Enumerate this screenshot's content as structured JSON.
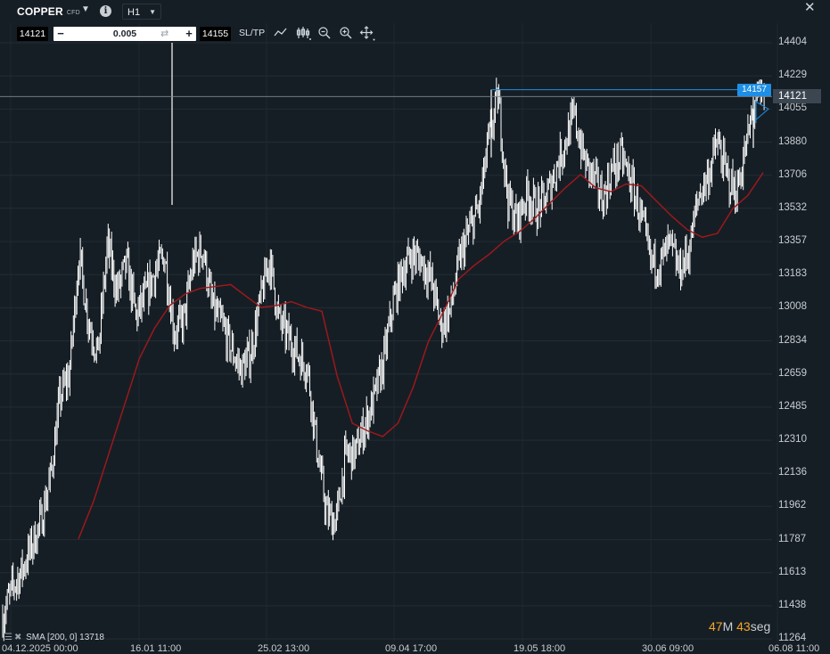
{
  "header": {
    "symbol": "COPPER",
    "symbol_suffix": "CFD",
    "timeframe": "H1",
    "close_glyph": "✕"
  },
  "order": {
    "bid": "14121",
    "ask": "14155",
    "quantity": "0.005",
    "minus": "−",
    "plus": "+",
    "sltp_label": "SL/TP"
  },
  "toolbar": {
    "icons": [
      "line-chart-icon",
      "indicators-icon",
      "zoom-out-icon",
      "zoom-in-icon",
      "crosshair-move-icon"
    ]
  },
  "price_axis": {
    "labels": [
      "14404",
      "14229",
      "14055",
      "13880",
      "13706",
      "13532",
      "13357",
      "13183",
      "13008",
      "12834",
      "12659",
      "12485",
      "12310",
      "12136",
      "11962",
      "11787",
      "11613",
      "11438",
      "11264"
    ],
    "current_price": "14121",
    "high_marker": "14157"
  },
  "time_axis": {
    "labels": [
      "04.12.2025 00:00",
      "16.01 11:00",
      "25.02 13:00",
      "09.04 17:00",
      "19.05 18:00",
      "30.06 09:00",
      "06.08 11:00"
    ]
  },
  "timer": {
    "minutes": "47",
    "m_unit": "M",
    "seconds": "43",
    "s_unit": "seg"
  },
  "legend": {
    "text": "SMA [200, 0] 13718"
  },
  "colors": {
    "background": "#161e25",
    "candles": "#ffffff",
    "sma": "#a3181b",
    "high_line": "#1e8fe6",
    "timer_accent": "#f5a623"
  },
  "chart_data": {
    "type": "line",
    "instrument": "COPPER",
    "timeframe": "H1",
    "ylim": [
      11264,
      14404
    ],
    "x": [
      "04.12.2025 00:00",
      "16.01 11:00",
      "25.02 13:00",
      "09.04 17:00",
      "19.05 18:00",
      "30.06 09:00",
      "06.08 11:00"
    ],
    "series": [
      {
        "name": "SMA [200, 0]",
        "values": [
          11790,
          11990,
          12240,
          12490,
          12740,
          12900,
          13020,
          13080,
          13110,
          13120,
          13130,
          13070,
          13010,
          13020,
          13040,
          13010,
          12990,
          12650,
          12400,
          12360,
          12330,
          12400,
          12590,
          12830,
          12990,
          13160,
          13230,
          13290,
          13360,
          13410,
          13480,
          13560,
          13640,
          13710,
          13640,
          13620,
          13660,
          13650,
          13570,
          13490,
          13420,
          13380,
          13400,
          13530,
          13600,
          13720
        ]
      }
    ],
    "price_path": [
      11380,
      11530,
      11620,
      11750,
      11880,
      12110,
      12530,
      12660,
      13290,
      12940,
      12760,
      13340,
      13090,
      13240,
      12960,
      13070,
      13200,
      13280,
      12880,
      12940,
      13250,
      13320,
      13010,
      12920,
      12790,
      12680,
      12760,
      13030,
      13270,
      12940,
      12850,
      12760,
      12690,
      12260,
      11920,
      11880,
      12230,
      12240,
      12390,
      12530,
      12730,
      13040,
      13210,
      13290,
      13250,
      13150,
      12910,
      13000,
      13270,
      13420,
      13540,
      13890,
      14120,
      13580,
      13460,
      13610,
      13530,
      13580,
      13730,
      13880,
      14020,
      13790,
      13690,
      13580,
      13740,
      13800,
      13660,
      13480,
      13250,
      13240,
      13340,
      13200,
      13300,
      13590,
      13700,
      13880,
      13700,
      13610,
      13850,
      14100,
      14121
    ],
    "annotations": {
      "period_high": 14157,
      "current_price": 14121
    }
  }
}
